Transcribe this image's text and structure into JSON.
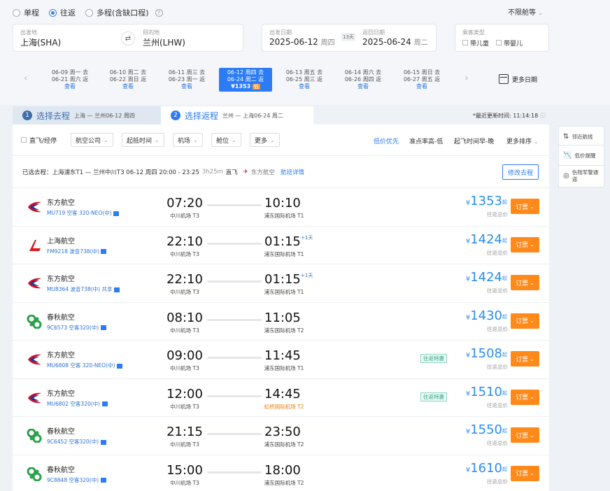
{
  "trip_types": [
    {
      "label": "单程",
      "selected": false
    },
    {
      "label": "往返",
      "selected": true
    },
    {
      "label": "多程(含缺口程)",
      "selected": false
    }
  ],
  "help_icon": "?",
  "cabin_class": "不限舱等",
  "departure": {
    "label": "出发地",
    "value": "上海(SHA)"
  },
  "destination": {
    "label": "目的地",
    "value": "兰州(LHW)"
  },
  "depart_date": {
    "label": "出发日期",
    "value": "2025-06-12",
    "dow": "周四"
  },
  "days_badge": "13天",
  "return_date": {
    "label": "返回日期",
    "value": "2025-06-24",
    "dow": "周二"
  },
  "passenger": {
    "label": "乘客类型",
    "child": "带儿童",
    "infant": "带婴儿"
  },
  "date_strip": [
    {
      "go": "06-09 周一 去",
      "ret": "06-21 周六 返",
      "link": "查看"
    },
    {
      "go": "06-10 周二 去",
      "ret": "06-22 周日 返",
      "link": "查看"
    },
    {
      "go": "06-11 周三 去",
      "ret": "06-23 周一 返",
      "link": "查看"
    },
    {
      "go": "06-12 周四 去",
      "ret": "06-24 周二 返",
      "price": "¥1353",
      "low": "低",
      "selected": true
    },
    {
      "go": "06-13 周五 去",
      "ret": "06-25 周三 返",
      "link": "查看"
    },
    {
      "go": "06-14 周六 去",
      "ret": "06-26 周四 返",
      "link": "查看"
    },
    {
      "go": "06-15 周日 去",
      "ret": "06-27 周五 返",
      "link": "查看"
    }
  ],
  "more_dates": "更多日期",
  "tab1": {
    "num": "1",
    "label": "选择去程",
    "sub": "上海 — 兰州06-12 周四"
  },
  "tab2": {
    "num": "2",
    "label": "选择返程",
    "sub": "兰州 — 上海06-24 周二"
  },
  "updated": "*最近更新时间: 11:14:18",
  "filters": {
    "direct": "直飞/经停",
    "airline": "航空公司",
    "time": "起抵时间",
    "airport": "机场",
    "cabin": "舱位",
    "more": "更多"
  },
  "sorts": {
    "low": "低价优先",
    "punctual": "准点率高-低",
    "dep": "起飞时间早-晚",
    "more": "更多排序"
  },
  "selected_outbound": {
    "text": "已选去程：上海浦东T1 — 兰州中川T3 06-12 周四 20:00 - 23:25",
    "dur": "3h25m",
    "direct": "直飞",
    "airline": "东方航空",
    "detail": "航班详情",
    "change": "修改去程"
  },
  "flights": [
    {
      "airline": "东方航空",
      "logo": "eastern",
      "fno": "MU719 空客 320-NEO(中)",
      "dep": "07:20",
      "dap": "中川机场 T3",
      "arr": "10:10",
      "aap": "浦东国际机场 T1",
      "plus": "",
      "tag": "",
      "price": "1353"
    },
    {
      "airline": "上海航空",
      "logo": "shanghai",
      "fno": "FM9218 波音738(中)",
      "dep": "22:10",
      "dap": "中川机场 T3",
      "arr": "01:15",
      "aap": "浦东国际机场 T1",
      "plus": "+1天",
      "tag": "",
      "price": "1424"
    },
    {
      "airline": "东方航空",
      "logo": "eastern",
      "fno": "MU8364 波音738(中)  共享",
      "dep": "22:10",
      "dap": "中川机场 T3",
      "arr": "01:15",
      "aap": "浦东国际机场 T1",
      "plus": "+1天",
      "tag": "",
      "price": "1424"
    },
    {
      "airline": "春秋航空",
      "logo": "spring",
      "fno": "9C6573 空客320(中)",
      "dep": "08:10",
      "dap": "中川机场 T3",
      "arr": "11:05",
      "aap": "浦东国际机场 T2",
      "plus": "",
      "tag": "",
      "price": "1430"
    },
    {
      "airline": "东方航空",
      "logo": "eastern",
      "fno": "MU6808 空客 320-NEO(中)",
      "dep": "09:00",
      "dap": "中川机场 T3",
      "arr": "11:45",
      "aap": "浦东国际机场 T1",
      "plus": "",
      "tag": "往返特惠",
      "price": "1508"
    },
    {
      "airline": "东方航空",
      "logo": "eastern",
      "fno": "MU6802 空客320(中)",
      "dep": "12:00",
      "dap": "中川机场 T3",
      "arr": "14:45",
      "aap": "虹桥国际机场 T2",
      "aap_orange": true,
      "plus": "",
      "tag": "往返特惠",
      "price": "1510"
    },
    {
      "airline": "春秋航空",
      "logo": "spring",
      "fno": "9C6452 空客320(中)",
      "dep": "21:15",
      "dap": "中川机场 T3",
      "arr": "23:50",
      "aap": "浦东国际机场 T2",
      "plus": "",
      "tag": "",
      "price": "1550"
    },
    {
      "airline": "春秋航空",
      "logo": "spring",
      "fno": "9C8848 空客320(中)",
      "dep": "15:00",
      "dap": "中川机场 T3",
      "arr": "18:00",
      "aap": "浦东国际机场 T2",
      "plus": "",
      "tag": "",
      "price": "1610"
    }
  ],
  "price_suffix": "起",
  "price_sub": "往返总价",
  "book": "订票",
  "side": {
    "nearby": "邻近航线",
    "alert": "低价提醒",
    "military": "伤残军警通道"
  }
}
